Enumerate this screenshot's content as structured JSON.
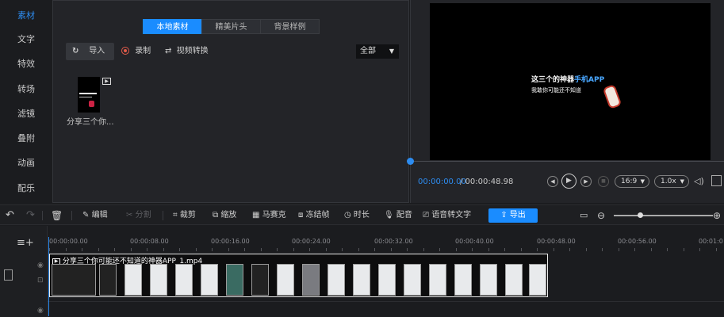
{
  "sidebar": {
    "items": [
      {
        "label": "素材",
        "active": true
      },
      {
        "label": "文字"
      },
      {
        "label": "特效"
      },
      {
        "label": "转场"
      },
      {
        "label": "滤镜"
      },
      {
        "label": "叠附"
      },
      {
        "label": "动画"
      },
      {
        "label": "配乐"
      }
    ]
  },
  "media": {
    "tabs": [
      {
        "label": "本地素材",
        "active": true
      },
      {
        "label": "精美片头"
      },
      {
        "label": "背景样例"
      }
    ],
    "import_label": "导入",
    "record_label": "录制",
    "convert_label": "视频转换",
    "filter_value": "全部",
    "files": [
      {
        "name": "分享三个你..."
      }
    ]
  },
  "preview": {
    "overlay_line1_prefix": "这三个的神器",
    "overlay_line1_highlight": "手机APP",
    "overlay_line2": "我敢你可能还不知道",
    "time_current": "00:00:00.00",
    "time_total": "/ 00:00:48.98",
    "aspect_ratio": "16:9",
    "speed": "1.0x"
  },
  "toolbar": {
    "edit": "编辑",
    "split": "分割",
    "crop": "裁剪",
    "zoom": "缩放",
    "mosaic": "马赛克",
    "freeze": "冻结帧",
    "duration": "时长",
    "dub": "配音",
    "speech_to_text": "语音转文字",
    "export": "导出"
  },
  "timeline": {
    "ruler": [
      "00:00:00.00",
      "00:00:08.00",
      "00:00:16.00",
      "00:00:24.00",
      "00:00:32.00",
      "00:00:40.00",
      "00:00:48.00",
      "00:00:56.00",
      "00:01:0"
    ],
    "clip_title": "分享三个你可能还不知道的神器APP_1.mp4"
  },
  "colors": {
    "accent": "#1a8cff",
    "background": "#1b1c1f",
    "panel": "#232428"
  }
}
